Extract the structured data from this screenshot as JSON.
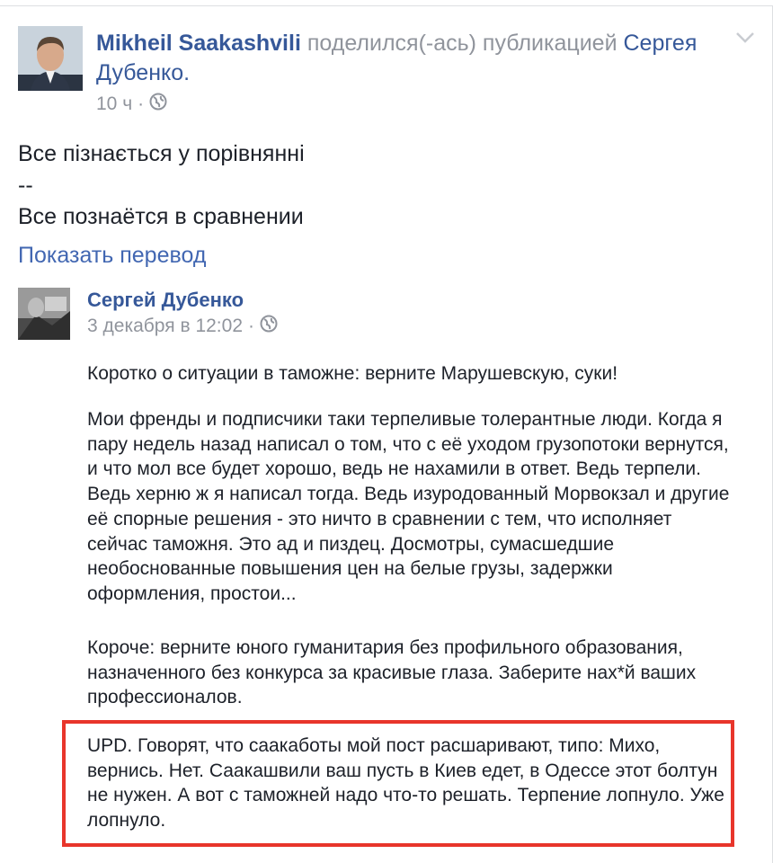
{
  "post": {
    "author_name": "Mikheil Saakashvili",
    "shared_phrase": " поделился(-ась) публикацией ",
    "shared_author_link": "Сергея Дубенко",
    "period": ".",
    "time": "10 ч",
    "separator": "·",
    "text_lines": [
      "Все пізнається у порівнянні",
      "--",
      "Все познаётся в сравнении"
    ],
    "see_translation": "Показать перевод"
  },
  "shared_post": {
    "author_name": "Сергей Дубенко",
    "time": "3 декабря в 12:02",
    "separator": "·",
    "paragraphs": [
      "Коротко о ситуации в таможне: верните Марушевскую, суки!",
      "Мои френды и подписчики таки терпеливые толерантные люди. Когда я пару недель назад написал о том, что с её уходом грузопотоки вернутся, и что мол все будет хорошо, ведь не нахамили в ответ. Ведь терпели. Ведь херню ж я написал тогда. Ведь изуродованный Морвокзал и другие её спорные решения - это ничто в сравнении с тем, что исполняет сейчас таможня. Это ад и пиздец. Досмотры, сумасшедшие необоснованные повышения цен на белые грузы, задержки оформления, простои...",
      "Короче: верните юного гуманитария без профильного образования, назначенного без конкурса за красивые глаза. Заберите нах*й ваших профессионалов.",
      "UPD. Говорят, что саакаботы мой пост расшаривают, типо: Михо, вернись. Нет. Саакашвили ваш пусть в Киев едет, в Одессе этот болтун не нужен. А вот с таможней надо что-то решать. Терпение лопнуло. Уже лопнуло."
    ]
  },
  "icons": {
    "audience": "globe-icon",
    "menu": "chevron-down-icon"
  },
  "colors": {
    "link": "#365899",
    "meta": "#90949c",
    "highlight": "#e8352b"
  }
}
